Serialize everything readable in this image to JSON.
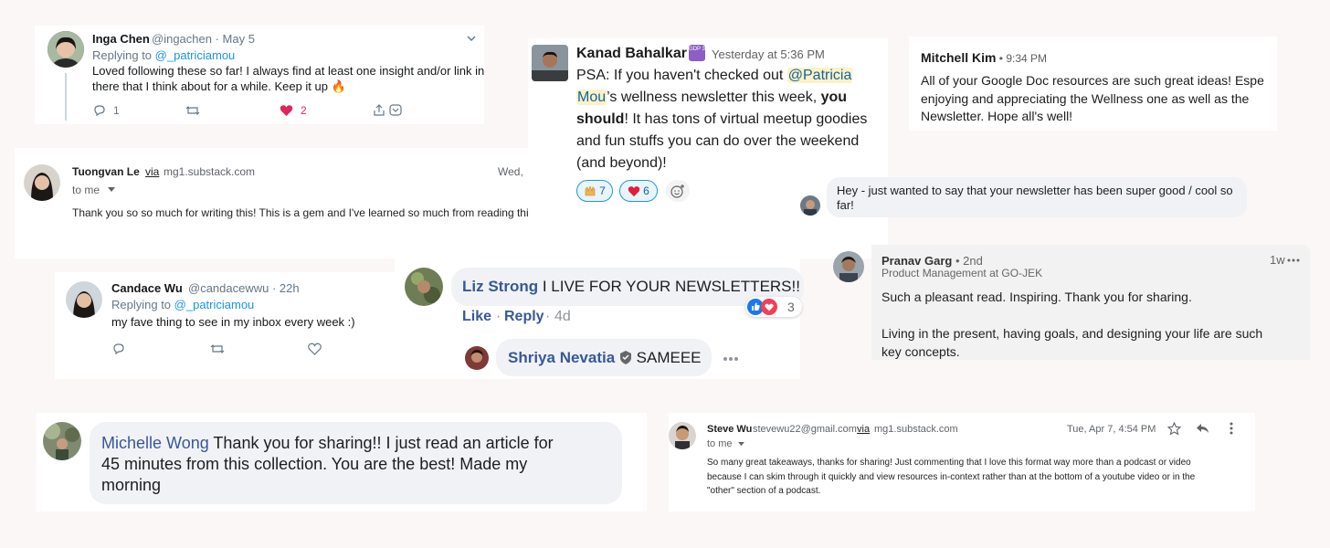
{
  "inga": {
    "name": "Inga Chen",
    "handle": "@ingachen · May 5",
    "replying_prefix": "Replying to ",
    "replying_handle": "@_patriciamou",
    "text_line1": "Loved following these so far! I always find at least one insight and/or link in",
    "text_line2": "there that I think about for a while. Keep it up 🔥",
    "reply_count": "1",
    "like_count": "2"
  },
  "tuongvan": {
    "name": "Tuongvan Le",
    "via": "via",
    "source": "mg1.substack.com",
    "date": "Wed,",
    "to": "to me",
    "text": "Thank you so so much for writing this! This is a gem and I've learned so much from reading this."
  },
  "kanad": {
    "name": "Kanad Bahalkar",
    "badge": "GDP 3",
    "time": "Yesterday at 5:36 PM",
    "line1_pre": "PSA: If you haven't checked out ",
    "mention_a": "@Patricia",
    "mention_b": "Mou",
    "line2_rest": "’s wellness newsletter this week, ",
    "line2_bold": "you",
    "line3_bold": "should",
    "line3_rest": "! It has tons of virtual meetup goodies",
    "line4": "and fun stuffs you can do over the weekend",
    "line5": "(and beyond)!",
    "reaction1_count": "7",
    "reaction2_count": "6"
  },
  "mitchell": {
    "name": "Mitchell Kim",
    "time": " • 9:34 PM",
    "line1": "All of your Google Doc resources are such great ideas! Espe",
    "line2": "enjoying and appreciating the Wellness one as well as the",
    "line3": "Newsletter. Hope all's well!"
  },
  "hey": {
    "line1": "Hey - just wanted to say that your newsletter has been super good / cool so",
    "line2": "far!"
  },
  "candace": {
    "name": "Candace Wu",
    "handle": "@candacewwu · 22h",
    "replying_prefix": "Replying to ",
    "replying_handle": "@_patriciamou",
    "text": "my fave thing to see in my inbox every week :)"
  },
  "liz": {
    "name": "Liz Strong",
    "text": "I LIVE FOR YOUR NEWSLETTERS!!",
    "like": "Like",
    "reply": "Reply",
    "age": "4d",
    "reaction_count": "3"
  },
  "shriya": {
    "name": "Shriya Nevatia",
    "text": "SAMEEE"
  },
  "pranav": {
    "name": "Pranav Garg",
    "degree": " • 2nd",
    "title": "Product Management at GO-JEK",
    "age": "1w",
    "text1": "Such a pleasant read. Inspiring. Thank you for sharing.",
    "text2_line1": "Living in the present, having goals, and designing your life are such",
    "text2_line2": "key concepts."
  },
  "michelle": {
    "name": "Michelle Wong",
    "line1": "Thank you for sharing!! I just read an article for",
    "line2": "45 minutes from this collection. You are the best! Made my",
    "line3": "morning"
  },
  "steve": {
    "name": "Steve Wu",
    "email": "stevewu22@gmail.com",
    "via": "via",
    "source": "mg1.substack.com",
    "date": "Tue, Apr 7, 4:54 PM",
    "to": "to me",
    "line1": "So many great takeaways, thanks for sharing! Just commenting that I love this format way more than a podcast or video",
    "line2": "because I can skim through it quickly and view resources in-context rather than at the bottom of a youtube video or in the",
    "line3": "\"other\" section of a podcast."
  },
  "colors": {
    "twitter_link": "#1b95e0",
    "heart": "#e0245e",
    "slack_mention_bg": "#fcf2c6",
    "slack_mention_fg": "#1264a3",
    "facebook_link": "#385898",
    "facebook_bubble": "#f0f2f5",
    "background": "#fcf7f7"
  }
}
